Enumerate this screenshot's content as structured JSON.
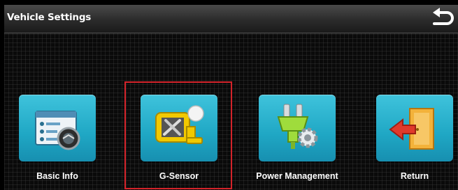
{
  "header": {
    "title": "Vehicle Settings",
    "back_icon": "return-arrow-icon"
  },
  "menu": {
    "items": [
      {
        "label": "Basic Info",
        "icon": "basic-info-icon"
      },
      {
        "label": "G-Sensor",
        "icon": "g-sensor-icon"
      },
      {
        "label": "Power Management",
        "icon": "power-management-icon"
      },
      {
        "label": "Return",
        "icon": "return-door-icon"
      }
    ],
    "selected_index": 1
  },
  "colors": {
    "tile": "#2bb3cf",
    "highlight": "#d4232a",
    "icon_yellow": "#f2c900",
    "arrow_red": "#e03a2b"
  }
}
